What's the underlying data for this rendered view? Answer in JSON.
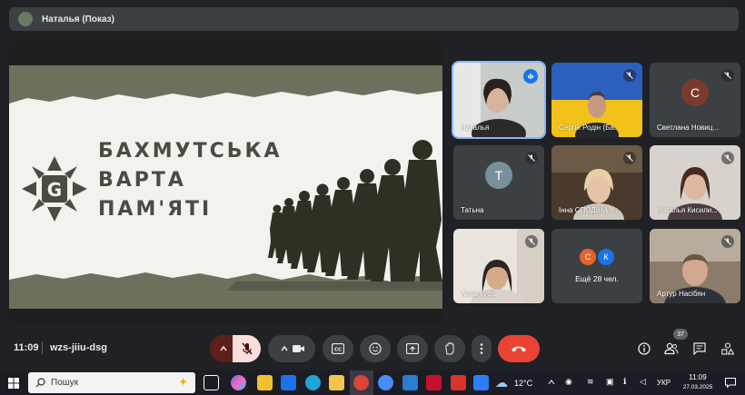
{
  "presenter": {
    "name": "Наталья (Показ)"
  },
  "slide": {
    "lines": [
      "БАХМУТСЬКА",
      "ВАРТА",
      "ПАМ'ЯТІ"
    ],
    "logo_letter": "G"
  },
  "participants": [
    {
      "name": "Наталья",
      "mic": "speaking",
      "tile_type": "video"
    },
    {
      "name": "Сергій Родін (Ба...",
      "mic": "muted",
      "tile_type": "video"
    },
    {
      "name": "Светлана Новиц...",
      "mic": "muted",
      "tile_type": "avatar",
      "initial": "С",
      "avatar_color": "#7b3b2c"
    },
    {
      "name": "Татьна",
      "mic": "muted",
      "tile_type": "avatar",
      "initial": "Т",
      "avatar_color": "#78909c"
    },
    {
      "name": "Інна СПОДІНА У...",
      "mic": "muted",
      "tile_type": "video"
    },
    {
      "name": "Наталья Кисили...",
      "mic": "muted",
      "tile_type": "video"
    },
    {
      "name": "Алла Губа",
      "mic": "muted",
      "tile_type": "video"
    },
    {
      "name": "Ещё 28 чел.",
      "tile_type": "more",
      "initials": [
        "С",
        "К"
      ]
    },
    {
      "name": "Артур Насібян",
      "mic": "muted",
      "tile_type": "video"
    }
  ],
  "controls": {
    "time": "11:09",
    "meeting_code": "wzs-jiiu-dsg",
    "people_count": "37",
    "accent_red": "#ea4335"
  },
  "taskbar": {
    "search_placeholder": "Пошук",
    "weather": "12°C",
    "language": "УКР",
    "time": "11:09",
    "date": "27.03.2025"
  }
}
